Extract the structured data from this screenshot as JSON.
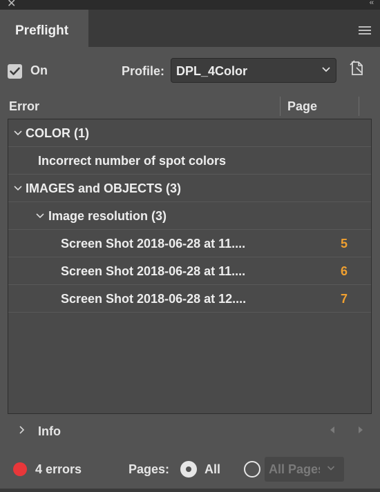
{
  "window": {
    "close_icon": "close-icon",
    "collapse_icon": "double-chevron-icon"
  },
  "panel": {
    "tab_label": "Preflight",
    "menu_icon": "hamburger-menu-icon"
  },
  "controls": {
    "on_checked": true,
    "on_label": "On",
    "profile_label": "Profile:",
    "profile_value": "DPL_4Color",
    "profiles_icon": "define-profiles-icon"
  },
  "table": {
    "headers": {
      "error": "Error",
      "page": "Page"
    },
    "rows": [
      {
        "text": "COLOR (1)",
        "level": 0,
        "expanded": true,
        "page": ""
      },
      {
        "text": "Incorrect number of spot colors",
        "level": 1,
        "page": ""
      },
      {
        "text": "IMAGES and OBJECTS (3)",
        "level": 0,
        "expanded": true,
        "page": ""
      },
      {
        "text": "Image resolution (3)",
        "level": 1,
        "expanded": true,
        "page": ""
      },
      {
        "text": "Screen Shot 2018-06-28 at 11....",
        "level": 2,
        "page": "5"
      },
      {
        "text": "Screen Shot 2018-06-28 at 11....",
        "level": 2,
        "page": "6"
      },
      {
        "text": "Screen Shot 2018-06-28 at 12....",
        "level": 2,
        "page": "7"
      }
    ]
  },
  "info": {
    "label": "Info"
  },
  "status": {
    "error_count_label": "4 errors",
    "status_color": "#e8373a",
    "pages_label": "Pages:",
    "all_label": "All",
    "range_placeholder": "All Pages"
  },
  "colors": {
    "page_number": "#f0a030",
    "panel_bg": "#535353"
  }
}
